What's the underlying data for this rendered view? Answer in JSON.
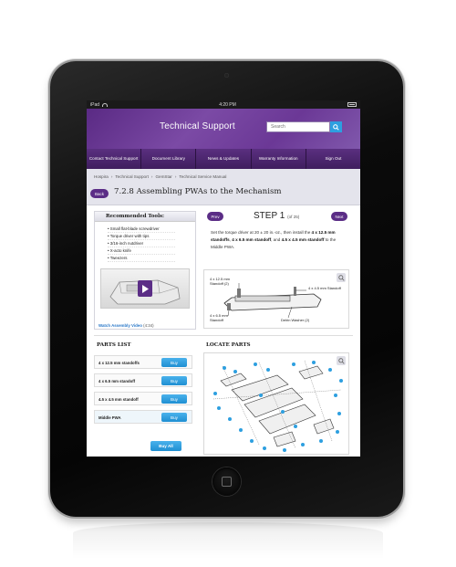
{
  "status_bar": {
    "carrier": "iPad",
    "time": "4:20 PM"
  },
  "header": {
    "title": "Technical Support",
    "search_placeholder": "Search"
  },
  "nav": {
    "items": [
      {
        "label": "Contact Technical Support"
      },
      {
        "label": "Document Library"
      },
      {
        "label": "News & Updates"
      },
      {
        "label": "Warranty Information"
      },
      {
        "label": "Sign Out"
      }
    ]
  },
  "breadcrumb": {
    "items": [
      "Hospira",
      "›",
      "Technical Support",
      "›",
      "GemStar",
      "›",
      "Technical Service Manual"
    ]
  },
  "back_label": "Back",
  "page_title": "7.2.8 Assembling PWAs to the Mechanism",
  "tools": {
    "heading": "Recommended Tools:",
    "items": [
      "Small flat-blade screwdriver",
      "Torque driver with tips",
      "3/16-inch nutdriver",
      "X-acto knife",
      "Tweezers"
    ],
    "video_link": "Watch Assembly Video",
    "video_duration": "(4:34)"
  },
  "step": {
    "prev_label": "Prev",
    "next_label": "Next",
    "label": "STEP 1",
    "count": "(of 25)",
    "text_intro": "Set the torque driver at 20 ± 20 in.-oz., then install the",
    "part_a": "4 x 12.5 mm standoffs",
    "part_b": "4 x 6.5 mm standoff",
    "part_c": "4.5 x 4.5 mm standoff",
    "text_end": "to the Middle PWA."
  },
  "diagram_callouts": {
    "a": "4 x 12.5 mm Standoff (2)",
    "b": "4 x 4.5 mm Standoff",
    "c": "4 x 6.5 mm Standoff",
    "d": "Delrin Washer (2)"
  },
  "parts": {
    "heading": "PARTS LIST",
    "items": [
      {
        "name": "4 x 12.5 mm standoffs",
        "buy": "Buy"
      },
      {
        "name": "4 x 6.5 mm standoff",
        "buy": "Buy"
      },
      {
        "name": "4.5 x 4.5 mm standoff",
        "buy": "Buy"
      },
      {
        "name": "Middle PWA",
        "buy": "Buy"
      }
    ],
    "buy_all": "Buy All"
  },
  "locate": {
    "heading": "LOCATE PARTS"
  },
  "colors": {
    "brand_purple": "#5b2d86",
    "accent_blue": "#2d9fe0"
  }
}
